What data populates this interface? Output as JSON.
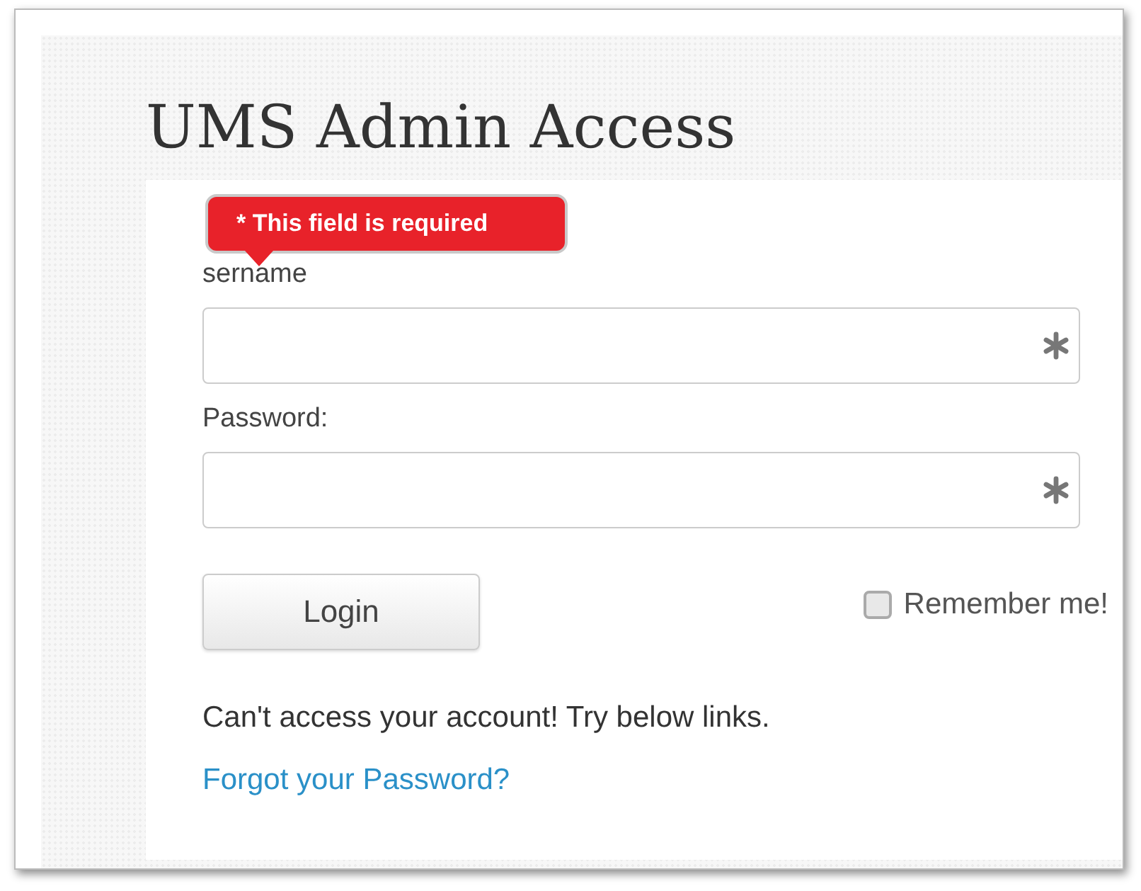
{
  "title": "UMS Admin Access",
  "tooltip": {
    "text": "* This field is required"
  },
  "fields": [
    {
      "label": "sername",
      "required": true
    },
    {
      "label": "Password:",
      "required": true
    }
  ],
  "login_button": "Login",
  "remember": {
    "label": "Remember me!",
    "checked": false
  },
  "help_text": "Can't access your account! Try below links.",
  "link": "Forgot your Password?"
}
